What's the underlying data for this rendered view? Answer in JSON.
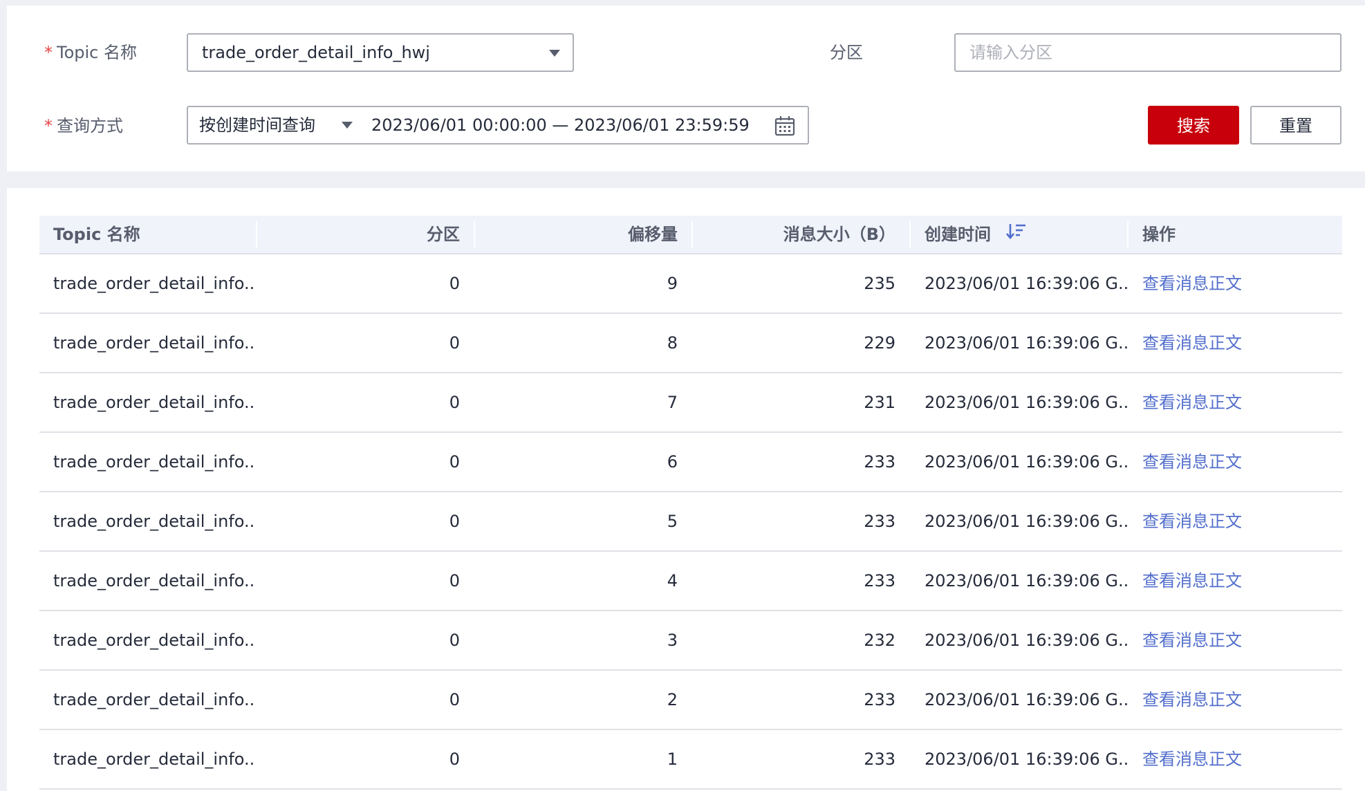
{
  "search": {
    "topic_label": "Topic 名称",
    "topic_value": "trade_order_detail_info_hwj",
    "partition_label": "分区",
    "partition_placeholder": "请输入分区",
    "query_label": "查询方式",
    "query_mode_value": "按创建时间查询",
    "date_range_value": "2023/06/01 00:00:00 — 2023/06/01 23:59:59",
    "required_mark": "*",
    "search_button": "搜索",
    "reset_button": "重置"
  },
  "table": {
    "columns": [
      "Topic 名称",
      "分区",
      "偏移量",
      "消息大小（B）",
      "创建时间",
      "操作"
    ],
    "rows": [
      {
        "topic": "trade_order_detail_info...",
        "partition": "0",
        "offset": "9",
        "size": "235",
        "created": "2023/06/01 16:39:06 G...",
        "action": "查看消息正文"
      },
      {
        "topic": "trade_order_detail_info...",
        "partition": "0",
        "offset": "8",
        "size": "229",
        "created": "2023/06/01 16:39:06 G...",
        "action": "查看消息正文"
      },
      {
        "topic": "trade_order_detail_info...",
        "partition": "0",
        "offset": "7",
        "size": "231",
        "created": "2023/06/01 16:39:06 G...",
        "action": "查看消息正文"
      },
      {
        "topic": "trade_order_detail_info...",
        "partition": "0",
        "offset": "6",
        "size": "233",
        "created": "2023/06/01 16:39:06 G...",
        "action": "查看消息正文"
      },
      {
        "topic": "trade_order_detail_info...",
        "partition": "0",
        "offset": "5",
        "size": "233",
        "created": "2023/06/01 16:39:06 G...",
        "action": "查看消息正文"
      },
      {
        "topic": "trade_order_detail_info...",
        "partition": "0",
        "offset": "4",
        "size": "233",
        "created": "2023/06/01 16:39:06 G...",
        "action": "查看消息正文"
      },
      {
        "topic": "trade_order_detail_info...",
        "partition": "0",
        "offset": "3",
        "size": "232",
        "created": "2023/06/01 16:39:06 G...",
        "action": "查看消息正文"
      },
      {
        "topic": "trade_order_detail_info...",
        "partition": "0",
        "offset": "2",
        "size": "233",
        "created": "2023/06/01 16:39:06 G...",
        "action": "查看消息正文"
      },
      {
        "topic": "trade_order_detail_info...",
        "partition": "0",
        "offset": "1",
        "size": "233",
        "created": "2023/06/01 16:39:06 G...",
        "action": "查看消息正文"
      }
    ]
  },
  "colors": {
    "primary": "#c7000b",
    "link": "#526ecc",
    "required": "#e54545",
    "header_bg": "#f0f3fa"
  },
  "icons": {
    "dropdown": "chevron-down-icon",
    "calendar": "calendar-icon",
    "sort": "sort-desc-icon"
  }
}
